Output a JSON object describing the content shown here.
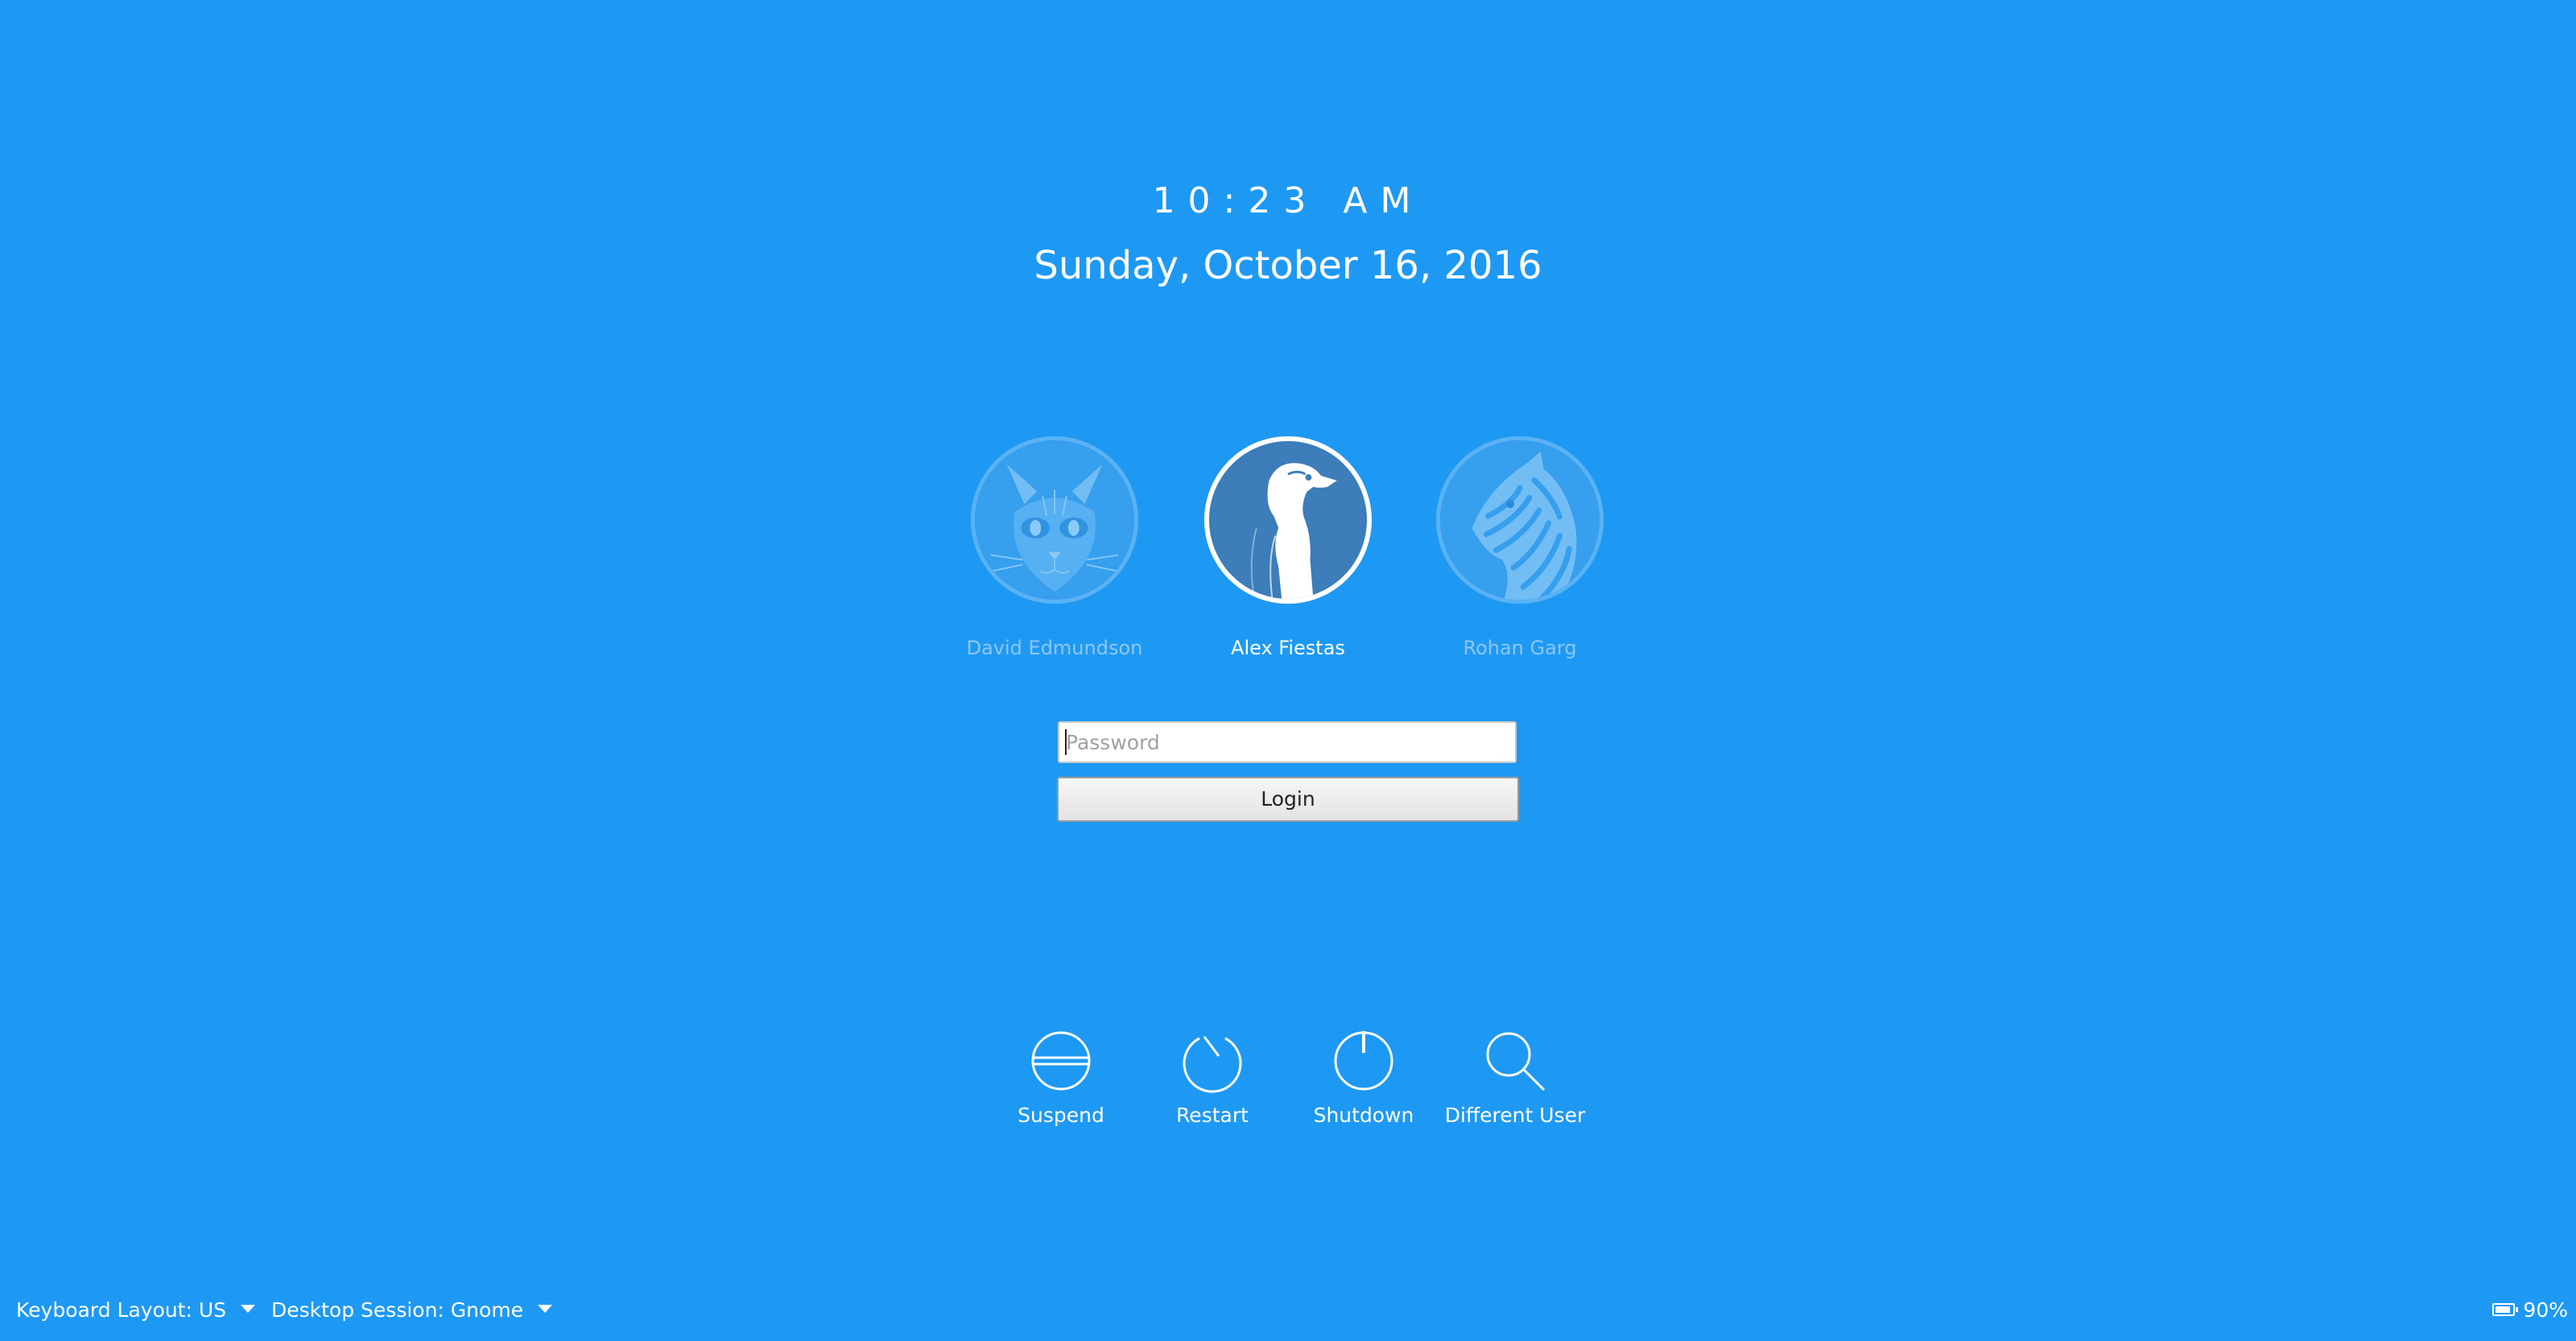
{
  "clock": {
    "time": "10:23 AM",
    "date": "Sunday, October 16, 2016"
  },
  "users": [
    {
      "name": "David Edmundson",
      "avatar_icon": "cat-avatar-icon",
      "selected": false
    },
    {
      "name": "Alex Fiestas",
      "avatar_icon": "penguin-avatar-icon",
      "selected": true
    },
    {
      "name": "Rohan Garg",
      "avatar_icon": "zebra-avatar-icon",
      "selected": false
    }
  ],
  "login": {
    "password_placeholder": "Password",
    "button_label": "Login"
  },
  "actions": [
    {
      "label": "Suspend",
      "icon": "suspend-icon"
    },
    {
      "label": "Restart",
      "icon": "restart-icon"
    },
    {
      "label": "Shutdown",
      "icon": "shutdown-icon"
    },
    {
      "label": "Different User",
      "icon": "search-icon"
    }
  ],
  "bottom_bar": {
    "keyboard_layout": "Keyboard Layout: US",
    "desktop_session": "Desktop Session: Gnome",
    "battery": "90%"
  },
  "colors": {
    "background": "#1e99f3",
    "avatar_selected_bg": "#3d7db9",
    "text": "#ffffff",
    "dim_text": "#8ec7f1"
  }
}
